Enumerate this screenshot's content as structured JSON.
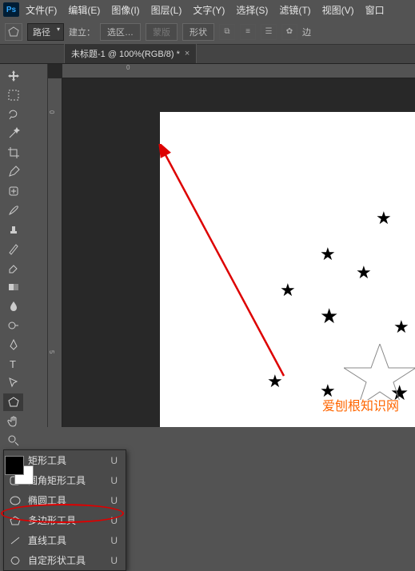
{
  "menubar": {
    "items": [
      "文件(F)",
      "编辑(E)",
      "图像(I)",
      "图层(L)",
      "文字(Y)",
      "选择(S)",
      "滤镜(T)",
      "视图(V)",
      "窗口"
    ]
  },
  "optionsbar": {
    "mode_dropdown": "路径",
    "build_label": "建立：",
    "sel_btn": "选区…",
    "mask_btn": "蒙版",
    "shape_btn": "形状",
    "edge_label": "边"
  },
  "document": {
    "tab_title": "未标题-1 @ 100%(RGB/8) *"
  },
  "rulers": {
    "h_ticks": [
      "0"
    ],
    "v_ticks": [
      "0",
      "5"
    ]
  },
  "shape_flyout": {
    "items": [
      {
        "label": "矩形工具",
        "key": "U",
        "icon": "rect"
      },
      {
        "label": "圆角矩形工具",
        "key": "U",
        "icon": "roundrect"
      },
      {
        "label": "椭圆工具",
        "key": "U",
        "icon": "ellipse"
      },
      {
        "label": "多边形工具",
        "key": "U",
        "icon": "polygon"
      },
      {
        "label": "直线工具",
        "key": "U",
        "icon": "line"
      },
      {
        "label": "自定形状工具",
        "key": "U",
        "icon": "custom"
      }
    ]
  },
  "colors": {
    "accent": "#ff6600",
    "annotation": "#d00000"
  },
  "watermark": "爱刨根知识网"
}
